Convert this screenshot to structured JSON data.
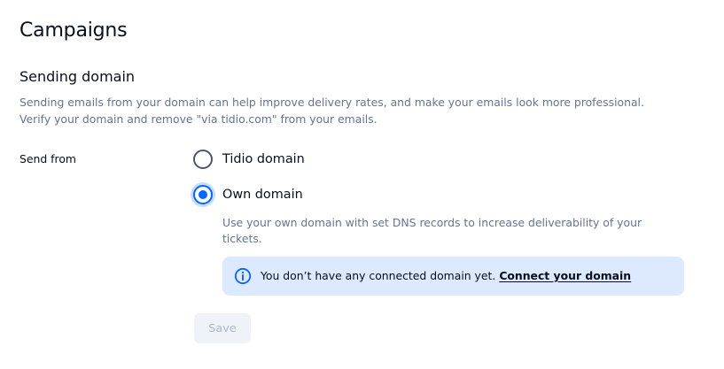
{
  "page": {
    "title": "Campaigns"
  },
  "sending_domain": {
    "title": "Sending domain",
    "description_line1": "Sending emails from your domain can help improve delivery rates, and make your emails look more professional.",
    "description_line2": "Verify your domain and remove \"via tidio.com\" from your emails.",
    "send_from_label": "Send from",
    "options": [
      {
        "label": "Tidio domain",
        "selected": false
      },
      {
        "label": "Own domain",
        "selected": true
      }
    ],
    "own_domain_description": "Use your own domain with set DNS records to increase deliverability of your tickets.",
    "info": {
      "icon": "info-icon",
      "text": "You don’t have any connected domain yet.",
      "link_text": "Connect your domain"
    },
    "save_label": "Save"
  },
  "colors": {
    "accent": "#0566ff",
    "info_background": "#dce9ff",
    "muted_text": "#647491",
    "disabled_button_bg": "#eff2f6",
    "disabled_button_text": "#acb8cb"
  }
}
